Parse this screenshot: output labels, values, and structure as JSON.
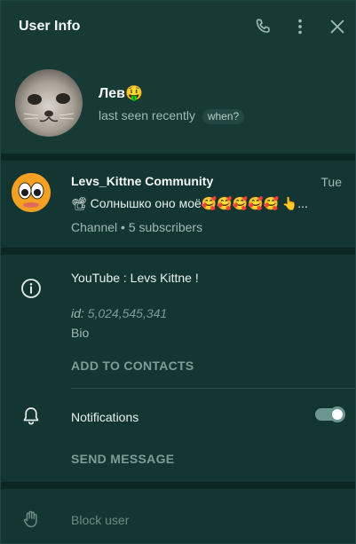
{
  "header": {
    "title": "User Info",
    "icons": [
      "phone-icon",
      "more-vertical-icon",
      "close-icon"
    ]
  },
  "profile": {
    "name": "Лев🤑",
    "status": "last seen recently",
    "status_hint": "when?"
  },
  "channel": {
    "title": "Levs_Kittne Community",
    "time": "Tue",
    "message": "📽 Солнышко оно моё🥰🥰🥰🥰🥰 👆...",
    "subtitle": "Channel • 5 subscribers"
  },
  "info": {
    "bio_text": "YouTube : Levs Kittne !",
    "id_label": "id:",
    "id_value": "5,024,545,341",
    "bio_label": "Bio",
    "add_contacts": "ADD TO CONTACTS",
    "notifications_label": "Notifications",
    "notifications_enabled": true,
    "send_message": "SEND MESSAGE"
  },
  "danger": {
    "block_label": "Block user"
  },
  "colors": {
    "background": "#12322e",
    "accent": "#6b9790",
    "muted_text": "#9fb9b4"
  }
}
